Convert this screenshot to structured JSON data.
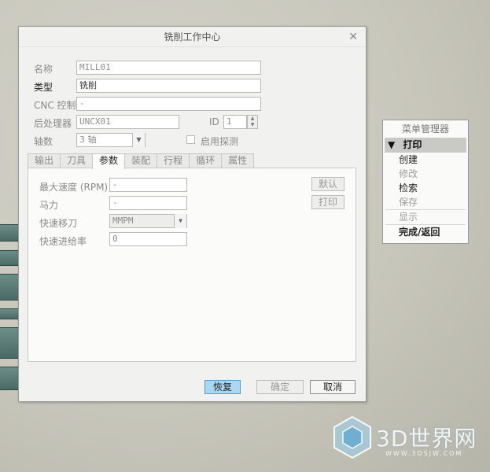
{
  "dialog": {
    "title": "铣削工作中心",
    "fields": {
      "name_label": "名称",
      "name_value": "MILL01",
      "type_label": "类型",
      "type_value": "铣削",
      "cnc_label": "CNC 控制",
      "cnc_value": "-",
      "post_label": "后处理器",
      "post_value": "UNCX01",
      "id_label": "ID",
      "id_value": "1",
      "axes_label": "轴数",
      "axes_value": "3 轴",
      "probe_label": "启用探测"
    },
    "tabs": [
      "输出",
      "刀具",
      "参数",
      "装配",
      "行程",
      "循环",
      "属性"
    ],
    "active_tab": "参数",
    "params": {
      "max_speed_label": "最大速度 (RPM)",
      "max_speed_value": "-",
      "horsepower_label": "马力",
      "horsepower_value": "-",
      "rapid_label": "快速移刀",
      "rapid_value": "MMPM",
      "rapid_feed_label": "快速进给率",
      "rapid_feed_value": "0",
      "default_button": "默认",
      "print_button": "打印"
    },
    "buttons": {
      "restore": "恢复",
      "ok": "确定",
      "cancel": "取消"
    }
  },
  "menu": {
    "title": "菜单管理器",
    "header": "打印",
    "items": [
      {
        "label": "创建",
        "disabled": false
      },
      {
        "label": "修改",
        "disabled": true
      },
      {
        "label": "检索",
        "disabled": false
      },
      {
        "label": "保存",
        "disabled": true
      },
      {
        "label": "显示",
        "disabled": true
      },
      {
        "label": "完成/返回",
        "disabled": false
      }
    ]
  },
  "watermark": {
    "brand": "3D世界网",
    "url": "WWW.3DSJW.COM"
  },
  "colors": {
    "primary_button": "#a9d8f2",
    "menu_header": "#c9c9c5"
  }
}
